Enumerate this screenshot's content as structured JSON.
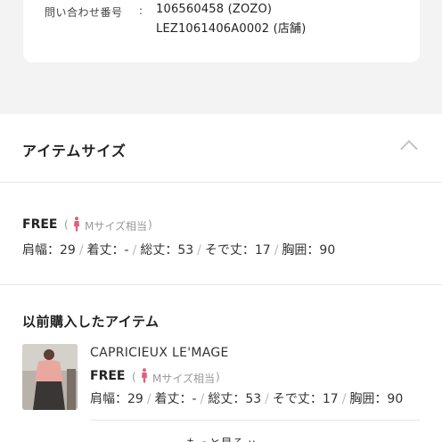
{
  "inquiry": {
    "label": "問い合わせ番号",
    "colon": ":",
    "value_zozo": "106560458 (ZOZO)",
    "value_store": "LEZ1061406A0002 (店舗)"
  },
  "item_size": {
    "title": "アイテムサイズ",
    "size_name": "FREE",
    "paren_open": "(",
    "paren_close": ")",
    "m_size_label": "Mサイズ相当",
    "measurements": [
      "肩幅：29",
      "着丈：-",
      "総丈：53",
      "そで丈：17",
      "胸囲：90"
    ]
  },
  "previous": {
    "title": "以前購入したアイテム",
    "brand": "CAPRICIEUX LE'MAGE",
    "size_name": "FREE",
    "m_size_label": "Mサイズ相当",
    "measurements": [
      "肩幅：29",
      "着丈：-",
      "総丈：53",
      "そで丈：17",
      "胸囲：90"
    ]
  },
  "see_more": "もっと見る ∨",
  "colors": {
    "page_bg": "#f3f3f3",
    "card_bg": "#ffffff",
    "accent_pink": "#e0607a",
    "muted": "#999999"
  }
}
